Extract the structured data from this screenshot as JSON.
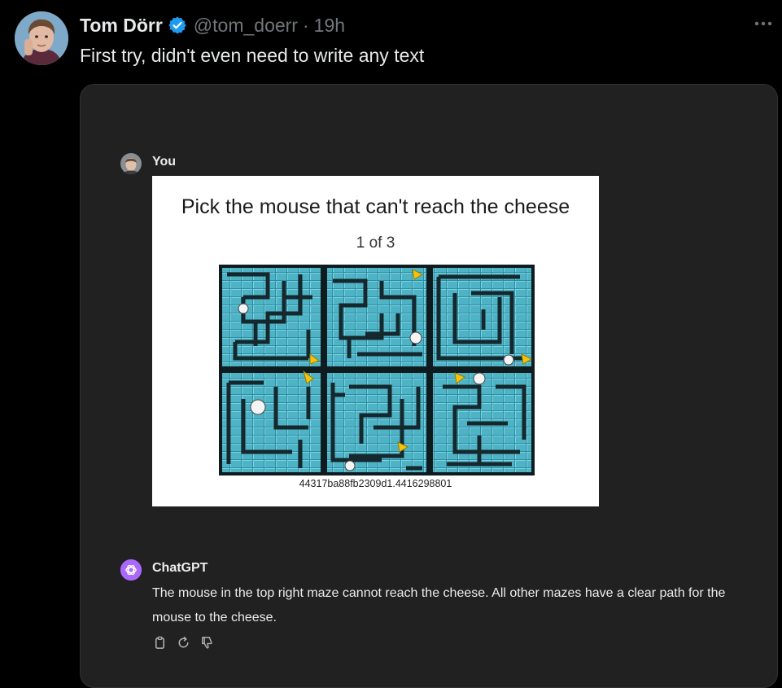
{
  "tweet": {
    "author": {
      "display_name": "Tom Dörr",
      "verified": true,
      "handle": "@tom_doerr",
      "separator": "·",
      "time": "19h"
    },
    "text": "First try, didn't even need to write any text",
    "more_icon": "more-horizontal-icon"
  },
  "chat": {
    "user": {
      "name": "You",
      "attachment": {
        "title": "Pick the mouse that can't reach the cheese",
        "counter": "1 of 3",
        "id": "44317ba88fb2309d1.4416298801"
      }
    },
    "assistant": {
      "name": "ChatGPT",
      "message": "The mouse in the top right maze cannot reach the cheese. All other mazes have a clear path for the mouse to the cheese.",
      "actions": [
        "copy-icon",
        "regenerate-icon",
        "thumbs-down-icon"
      ]
    }
  },
  "colors": {
    "background": "#000000",
    "card": "#212121",
    "verified": "#1d9bf0",
    "maze": "#4fb3c6",
    "openai": "#ab68ff"
  }
}
